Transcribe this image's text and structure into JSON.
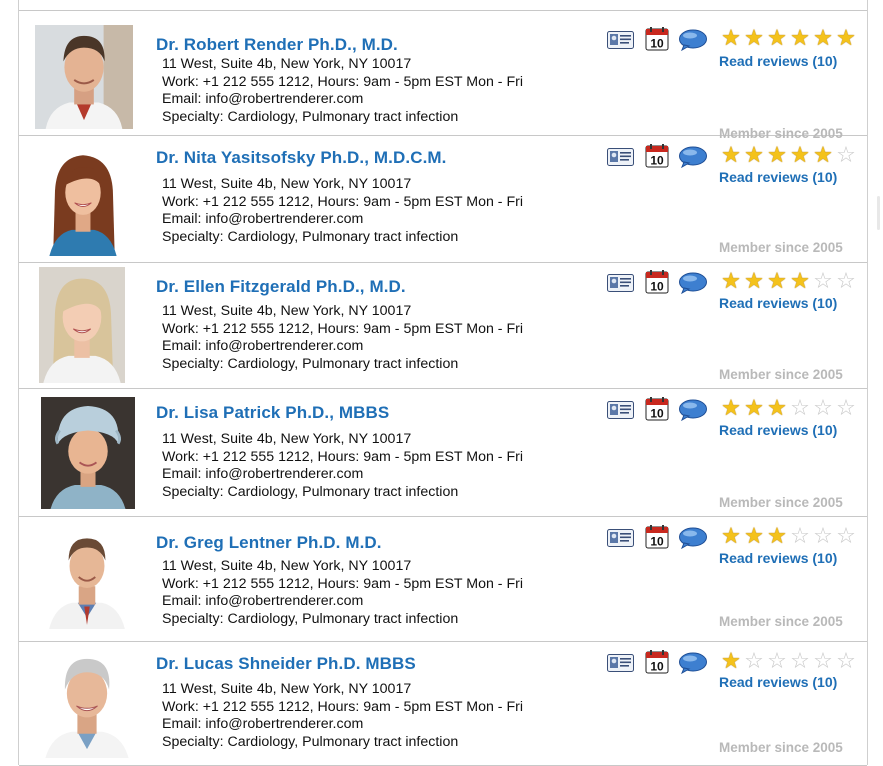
{
  "doctors": [
    {
      "name": "Dr. Robert Render Ph.D., M.D.",
      "address": "11 West, Suite 4b, New York, NY 10017",
      "work": "Work: +1 212 555 1212, Hours: 9am - 5pm EST Mon - Fri",
      "email": "Email: info@robertrenderer.com",
      "specialty": "Specialty: Cardiology, Pulmonary tract infection",
      "rating": 6,
      "rating_max": 6,
      "reviews_link": "Read reviews (10)",
      "member_since": "Member since 2005",
      "photo_icon": "doctor-photo-male-dark-hair",
      "calendar_day": "10"
    },
    {
      "name": "Dr. Nita Yasitsofsky Ph.D., M.D.C.M.",
      "address": "11 West, Suite 4b, New York, NY 10017",
      "work": "Work: +1 212 555 1212, Hours: 9am - 5pm EST Mon - Fri",
      "email": "Email: info@robertrenderer.com",
      "specialty": "Specialty: Cardiology, Pulmonary tract infection",
      "rating": 5,
      "rating_max": 6,
      "reviews_link": "Read reviews (10)",
      "member_since": "Member since 2005",
      "photo_icon": "doctor-photo-female-brown-hair",
      "calendar_day": "10"
    },
    {
      "name": "Dr. Ellen Fitzgerald Ph.D., M.D.",
      "address": "11 West, Suite 4b, New York, NY 10017",
      "work": "Work: +1 212 555 1212, Hours: 9am - 5pm EST Mon - Fri",
      "email": "Email: info@robertrenderer.com",
      "specialty": "Specialty: Cardiology, Pulmonary tract infection",
      "rating": 4,
      "rating_max": 6,
      "reviews_link": "Read reviews (10)",
      "member_since": "Member since 2005",
      "photo_icon": "doctor-photo-female-blonde-hair",
      "calendar_day": "10"
    },
    {
      "name": "Dr. Lisa Patrick Ph.D., MBBS",
      "address": "11 West, Suite 4b, New York, NY 10017",
      "work": "Work: +1 212 555 1212, Hours: 9am - 5pm EST Mon - Fri",
      "email": "Email: info@robertrenderer.com",
      "specialty": "Specialty: Cardiology, Pulmonary tract infection",
      "rating": 3,
      "rating_max": 6,
      "reviews_link": "Read reviews (10)",
      "member_since": "Member since 2005",
      "photo_icon": "doctor-photo-female-surgical-cap",
      "calendar_day": "10"
    },
    {
      "name": "Dr. Greg Lentner Ph.D. M.D.",
      "address": "11 West, Suite 4b, New York, NY 10017",
      "work": "Work: +1 212 555 1212, Hours: 9am - 5pm EST Mon - Fri",
      "email": "Email: info@robertrenderer.com",
      "specialty": "Specialty: Cardiology, Pulmonary tract infection",
      "rating": 3,
      "rating_max": 6,
      "reviews_link": "Read reviews (10)",
      "member_since": "Member since 2005",
      "photo_icon": "doctor-photo-male-short-hair",
      "calendar_day": "10"
    },
    {
      "name": "Dr. Lucas Shneider Ph.D. MBBS",
      "address": "11 West, Suite 4b, New York, NY 10017",
      "work": "Work: +1 212 555 1212, Hours: 9am - 5pm EST Mon - Fri",
      "email": "Email: info@robertrenderer.com",
      "specialty": "Specialty: Cardiology, Pulmonary tract infection",
      "rating": 1,
      "rating_max": 6,
      "reviews_link": "Read reviews (10)",
      "member_since": "Member since 2005",
      "photo_icon": "doctor-photo-male-gray-hair",
      "calendar_day": "10"
    }
  ],
  "icons": {
    "contact_card": "contact-card-icon",
    "calendar": "calendar-icon",
    "chat": "chat-bubble-icon"
  },
  "colors": {
    "name_link": "#1f6fb6",
    "star_on": "#f4c21b",
    "member_text": "#b9b9b9"
  }
}
